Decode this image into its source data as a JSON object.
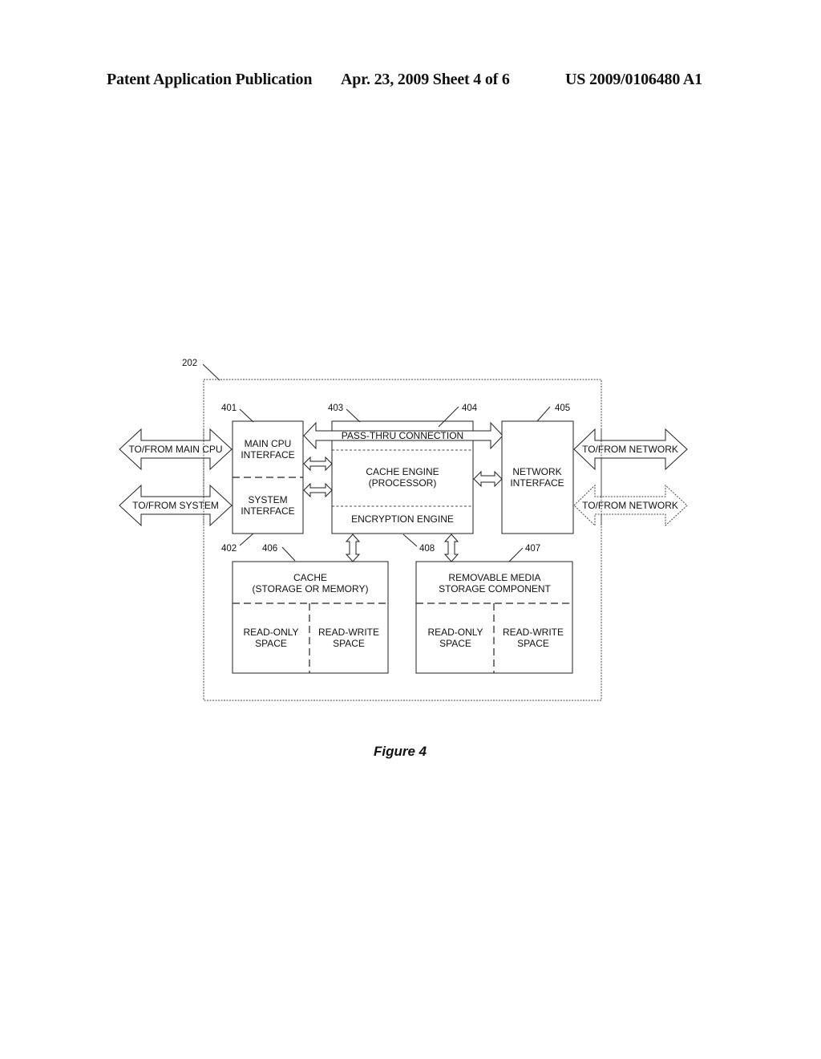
{
  "header": {
    "left": "Patent Application Publication",
    "center": "Apr. 23, 2009  Sheet 4 of 6",
    "right": "US 2009/0106480 A1"
  },
  "figure": {
    "caption": "Figure 4",
    "outer_ref": "202",
    "refs": {
      "main_cpu_interface": "401",
      "system_interface": "402",
      "cache_engine_block": "403",
      "pass_thru": "404",
      "network_interface": "405",
      "cache": "406",
      "removable_media": "407",
      "encryption_engine": "408"
    },
    "blocks": {
      "main_cpu_interface": [
        "MAIN CPU",
        "INTERFACE"
      ],
      "system_interface": [
        "SYSTEM",
        "INTERFACE"
      ],
      "pass_thru": "PASS-THRU CONNECTION",
      "cache_engine": [
        "CACHE ENGINE",
        "(PROCESSOR)"
      ],
      "encryption_engine": "ENCRYPTION ENGINE",
      "network_interface": [
        "NETWORK",
        "INTERFACE"
      ],
      "cache": [
        "CACHE",
        "(STORAGE OR MEMORY)"
      ],
      "cache_read_only": [
        "READ-ONLY",
        "SPACE"
      ],
      "cache_read_write": [
        "READ-WRITE",
        "SPACE"
      ],
      "removable_media": [
        "REMOVABLE MEDIA",
        "STORAGE COMPONENT"
      ],
      "removable_read_only": [
        "READ-ONLY",
        "SPACE"
      ],
      "removable_read_write": [
        "READ-WRITE",
        "SPACE"
      ]
    },
    "external_arrows": {
      "main_cpu": "TO/FROM MAIN CPU",
      "system": "TO/FROM SYSTEM",
      "network_1": "TO/FROM NETWORK",
      "network_2": "TO/FROM NETWORK"
    }
  }
}
